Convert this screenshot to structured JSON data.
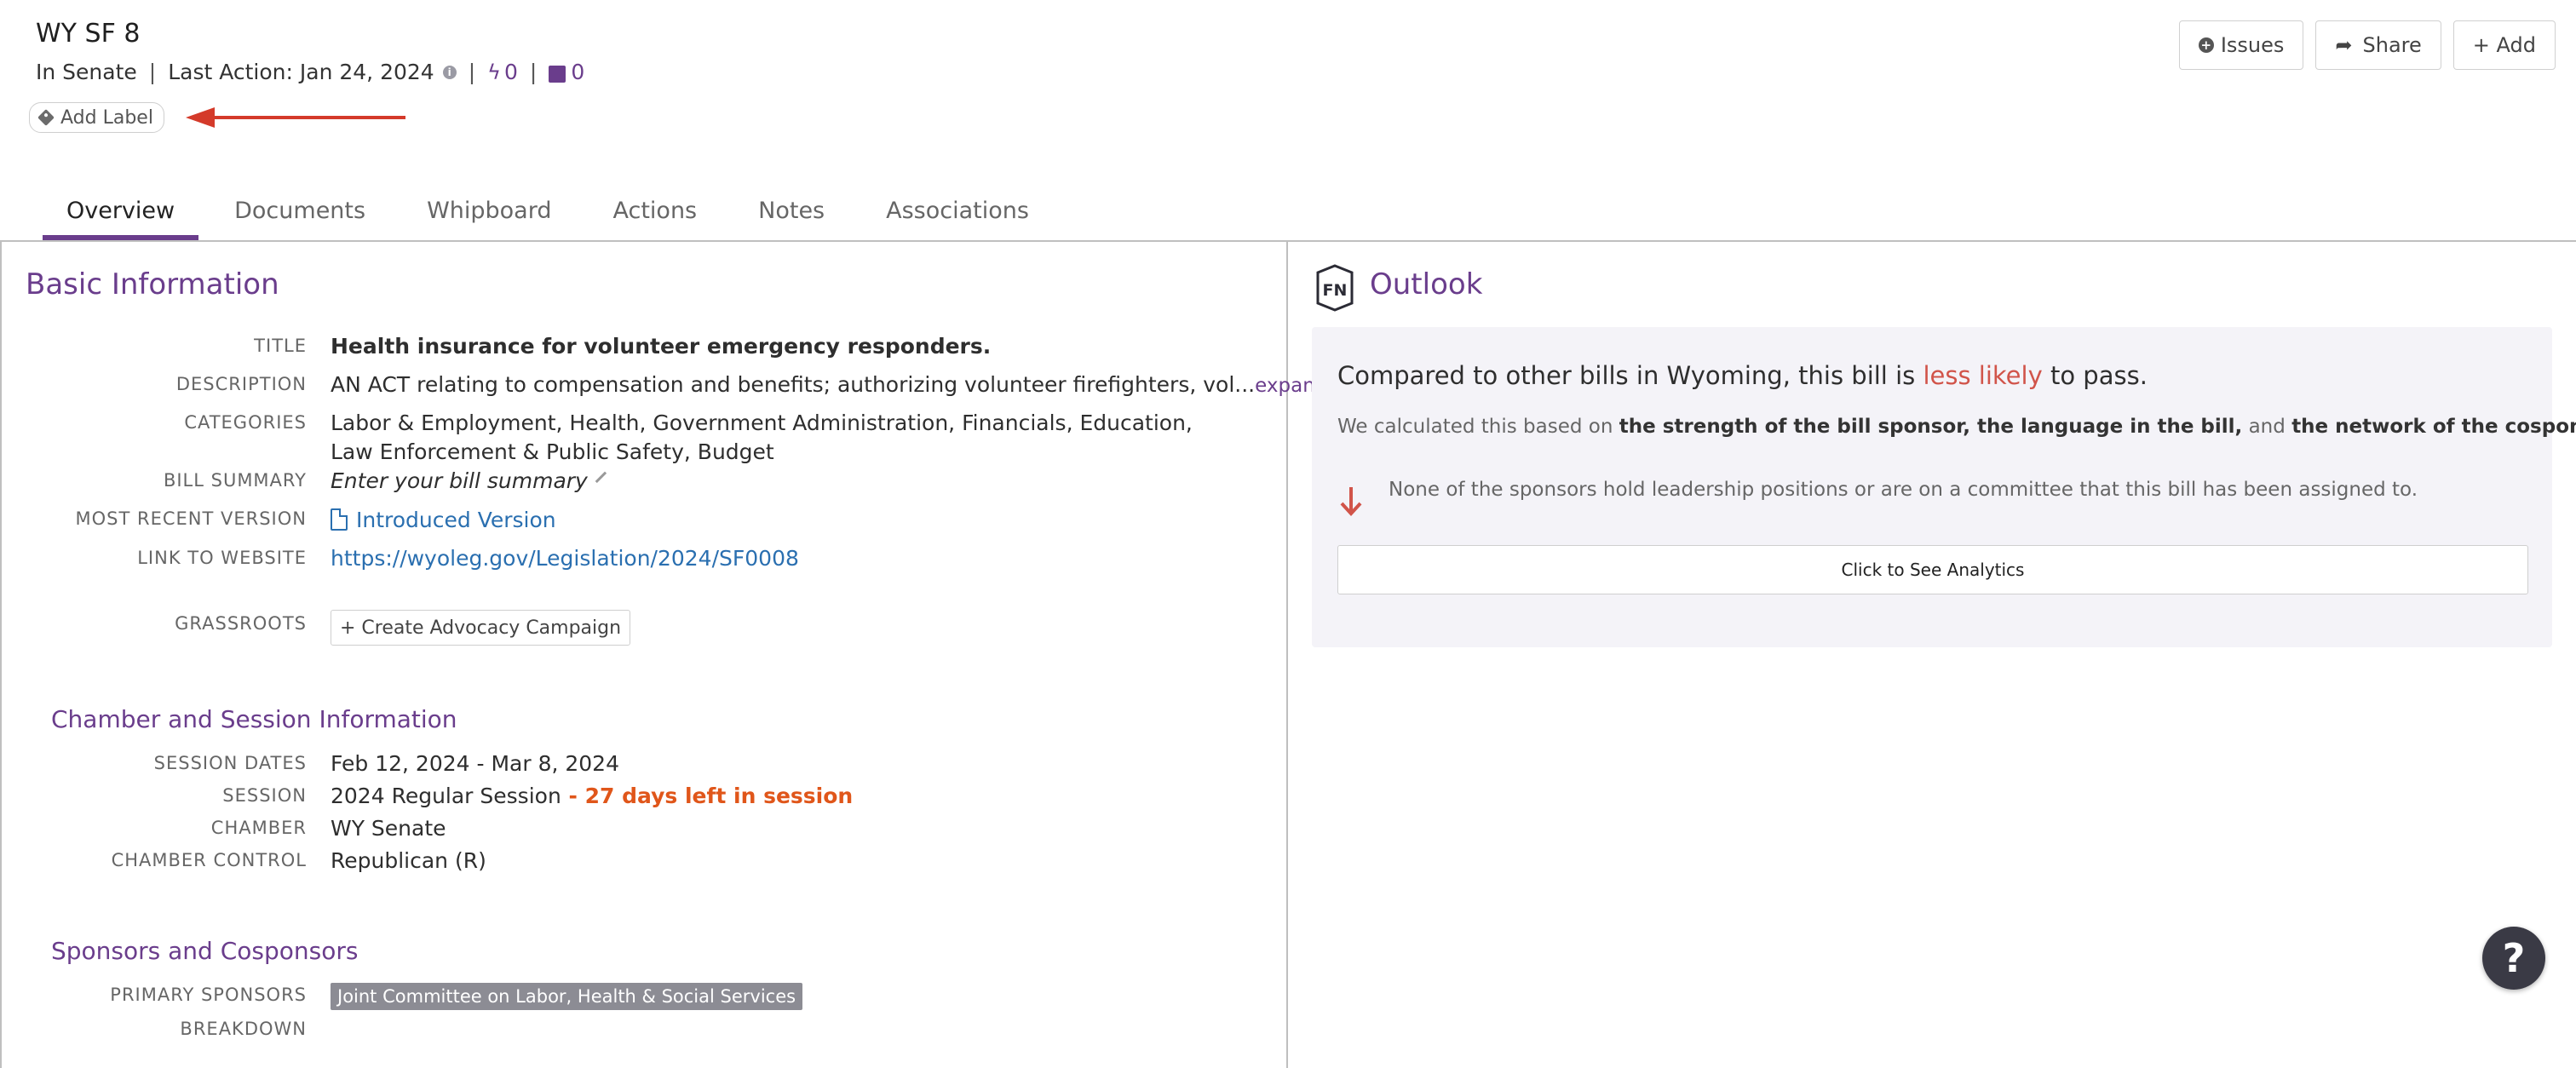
{
  "bill": {
    "title": "WY SF 8",
    "status": "In Senate",
    "last_action": "Last Action: Jan 24, 2024",
    "actions_count": "0",
    "notes_count": "0",
    "add_label": "Add Label"
  },
  "toolbar": {
    "issues_label": "Issues",
    "share_label": "Share",
    "add_label": "+ Add"
  },
  "tabs": [
    {
      "label": "Overview",
      "active": true
    },
    {
      "label": "Documents",
      "active": false
    },
    {
      "label": "Whipboard",
      "active": false
    },
    {
      "label": "Actions",
      "active": false
    },
    {
      "label": "Notes",
      "active": false
    },
    {
      "label": "Associations",
      "active": false
    }
  ],
  "basic_info": {
    "heading": "Basic Information",
    "title_label": "TITLE",
    "title_value": "Health insurance for volunteer emergency responders.",
    "description_label": "DESCRIPTION",
    "description_value": "AN ACT relating to compensation and benefits; authorizing volunteer firefighters, vol...",
    "expand_label": "expand",
    "categories_label": "CATEGORIES",
    "categories_line1": "Labor & Employment, Health, Government Administration, Financials, Education,",
    "categories_line2": "Law Enforcement & Public Safety, Budget",
    "summary_label": "BILL SUMMARY",
    "summary_placeholder": "Enter your bill summary",
    "version_label": "MOST RECENT VERSION",
    "version_value": "Introduced Version",
    "website_label": "LINK TO WEBSITE",
    "website_value": "https://wyoleg.gov/Legislation/2024/SF0008",
    "grassroots_label": "GRASSROOTS",
    "grassroots_button": "+ Create Advocacy Campaign"
  },
  "chamber": {
    "heading": "Chamber and Session Information",
    "dates_label": "SESSION DATES",
    "dates_value": "Feb 12, 2024 - Mar 8, 2024",
    "session_label": "SESSION",
    "session_value": "2024 Regular Session",
    "session_remaining": " - 27 days left in session",
    "chamber_label": "CHAMBER",
    "chamber_value": "WY Senate",
    "control_label": "CHAMBER CONTROL",
    "control_value": "Republican (R)"
  },
  "sponsors": {
    "heading": "Sponsors and Cosponsors",
    "primary_label": "PRIMARY SPONSORS",
    "primary_value": "Joint Committee on Labor, Health & Social Services",
    "breakdown_label": "BREAKDOWN"
  },
  "outlook": {
    "logo_text": "FN",
    "title": "Outlook",
    "head_pre": "Compared to other bills in Wyoming, this bill is ",
    "head_emph": "less likely",
    "head_post": " to pass.",
    "calc_pre": "We calculated this based on ",
    "calc_b1": "the strength of the bill sponsor, the language in the bill,",
    "calc_mid": " and ",
    "calc_b2": "the network of the cosponsors.",
    "reason": "None of the sponsors hold leadership positions or are on a committee that this bill has been assigned to.",
    "analytics_button": "Click to See Analytics"
  },
  "help": {
    "label": "?"
  },
  "colors": {
    "accent": "#6a3d8c",
    "link": "#2a6fb0",
    "warning": "#e0561a",
    "negative": "#d1544a"
  }
}
